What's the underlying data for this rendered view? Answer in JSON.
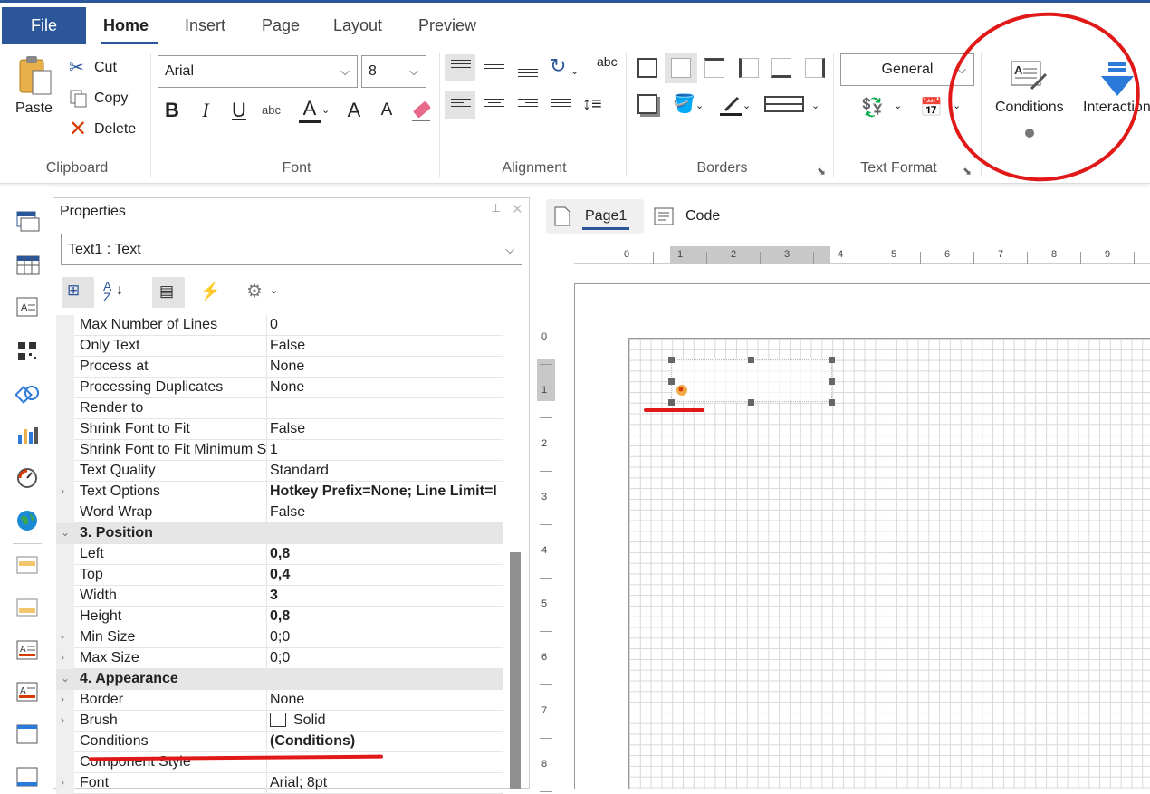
{
  "ribbon": {
    "tabs": {
      "file": "File",
      "home": "Home",
      "insert": "Insert",
      "page": "Page",
      "layout": "Layout",
      "preview": "Preview"
    },
    "clipboard": {
      "label": "Clipboard",
      "paste": "Paste",
      "cut": "Cut",
      "copy": "Copy",
      "delete": "Delete"
    },
    "font": {
      "label": "Font",
      "family": "Arial",
      "size": "8",
      "buttons": {
        "bold": "B",
        "italic": "I",
        "underline": "U",
        "strike": "abc",
        "color": "A",
        "grow": "A",
        "shrink": "A"
      }
    },
    "alignment": {
      "label": "Alignment",
      "wrap_label": "abc"
    },
    "borders": {
      "label": "Borders"
    },
    "text_format": {
      "label": "Text Format",
      "format": "General"
    },
    "conditions": "Conditions",
    "interaction": "Interaction"
  },
  "properties": {
    "title": "Properties",
    "object": "Text1 : Text",
    "rows": [
      {
        "name": "Max Number of Lines",
        "value": "0"
      },
      {
        "name": "Only Text",
        "value": "False"
      },
      {
        "name": "Process at",
        "value": "None"
      },
      {
        "name": "Processing Duplicates",
        "value": "None"
      },
      {
        "name": "Render to",
        "value": ""
      },
      {
        "name": "Shrink Font to Fit",
        "value": "False"
      },
      {
        "name": "Shrink Font to Fit Minimum S",
        "value": "1"
      },
      {
        "name": "Text Quality",
        "value": "Standard"
      },
      {
        "name": "Text Options",
        "value": "Hotkey Prefix=None; Line Limit=I"
      },
      {
        "name": "Word Wrap",
        "value": "False"
      },
      {
        "name": "3. Position",
        "value": ""
      },
      {
        "name": "Left",
        "value": "0,8"
      },
      {
        "name": "Top",
        "value": "0,4"
      },
      {
        "name": "Width",
        "value": "3"
      },
      {
        "name": "Height",
        "value": "0,8"
      },
      {
        "name": "Min Size",
        "value": "0;0"
      },
      {
        "name": "Max Size",
        "value": "0;0"
      },
      {
        "name": "4. Appearance",
        "value": ""
      },
      {
        "name": "Border",
        "value": "None"
      },
      {
        "name": "Brush",
        "value": "Solid"
      },
      {
        "name": "Conditions",
        "value": "(Conditions)"
      },
      {
        "name": "Component Style",
        "value": ""
      },
      {
        "name": "Font",
        "value": "Arial; 8pt"
      }
    ]
  },
  "designer": {
    "tabs": {
      "page1": "Page1",
      "code": "Code"
    },
    "hruler": [
      "0",
      "1",
      "2",
      "3",
      "4",
      "5",
      "6",
      "7",
      "8",
      "9"
    ],
    "vruler": [
      "0",
      "1",
      "2",
      "3",
      "4",
      "5",
      "6",
      "7",
      "8"
    ]
  },
  "colors": {
    "accent": "#2b579a",
    "annotation": "#e01818"
  }
}
